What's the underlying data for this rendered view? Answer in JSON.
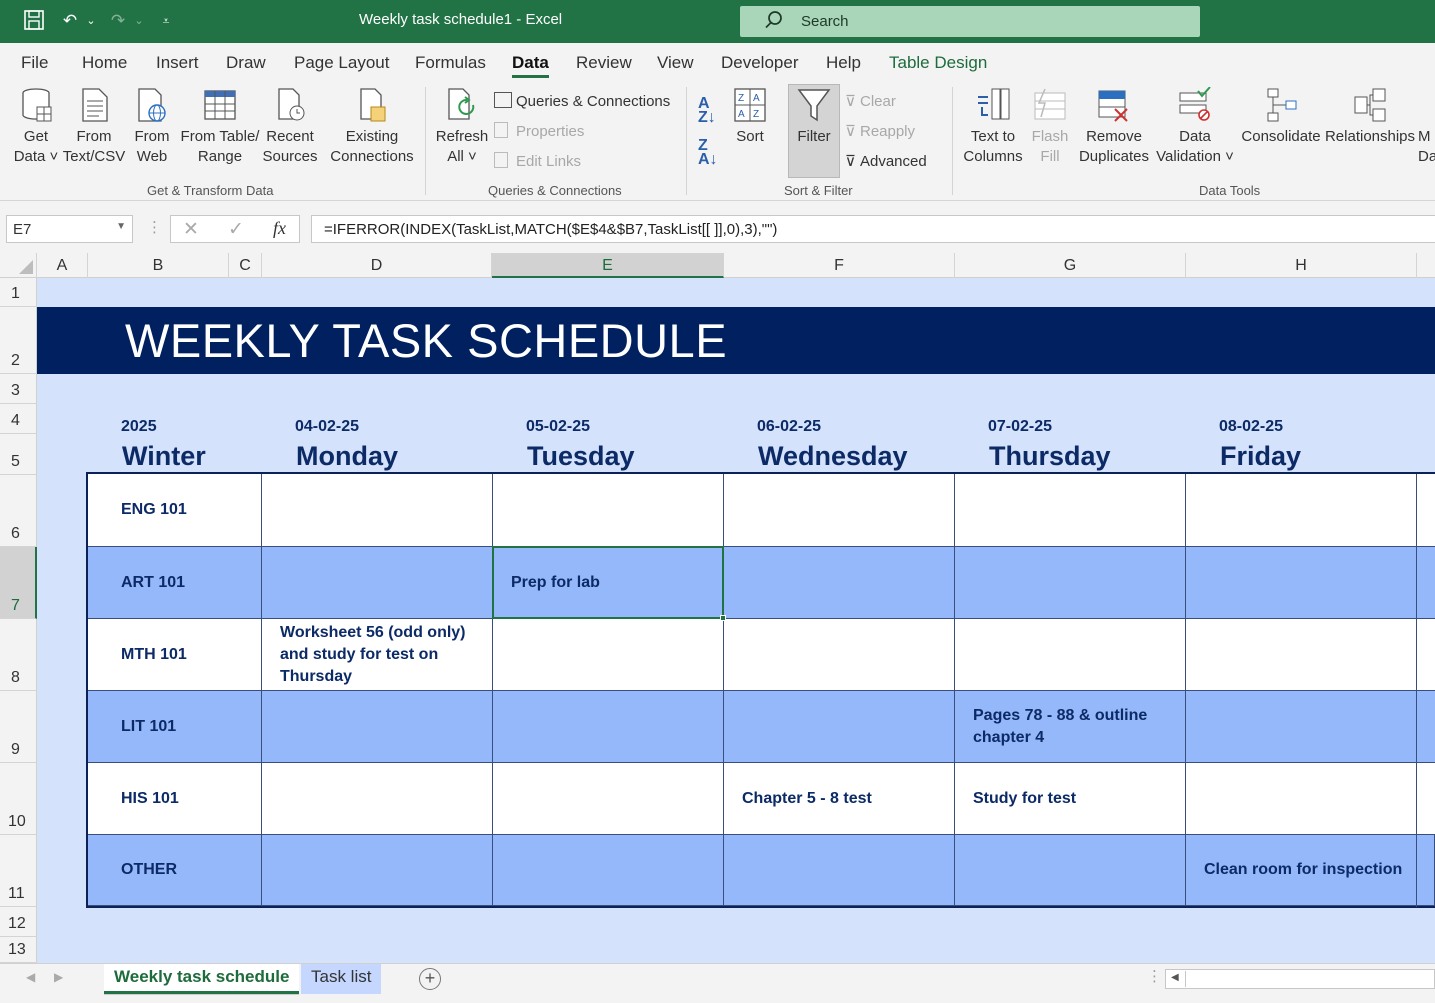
{
  "titlebar": {
    "doc_title": "Weekly task schedule1  -  Excel",
    "search_label": "Search"
  },
  "menu": {
    "items": [
      "File",
      "Home",
      "Insert",
      "Draw",
      "Page Layout",
      "Formulas",
      "Data",
      "Review",
      "View",
      "Developer",
      "Help",
      "Table Design"
    ],
    "active": "Data"
  },
  "ribbon": {
    "get_data": "Get\nData ˅",
    "from_text": "From\nText/CSV",
    "from_web": "From\nWeb",
    "from_table": "From Table/\nRange",
    "recent_sources": "Recent\nSources",
    "existing_connections": "Existing\nConnections",
    "group_get_transform": "Get & Transform Data",
    "refresh_all": "Refresh\nAll ˅",
    "queries_connections": "Queries & Connections",
    "properties": "Properties",
    "edit_links": "Edit Links",
    "group_queries": "Queries & Connections",
    "sort": "Sort",
    "filter": "Filter",
    "clear": "Clear",
    "reapply": "Reapply",
    "advanced": "Advanced",
    "group_sort_filter": "Sort & Filter",
    "text_to_columns": "Text to\nColumns",
    "flash_fill": "Flash\nFill",
    "remove_duplicates": "Remove\nDuplicates",
    "data_validation": "Data\nValidation ˅",
    "consolidate": "Consolidate",
    "relationships": "Relationships",
    "manage_partial": "M\nDa",
    "group_data_tools": "Data Tools"
  },
  "formula_bar": {
    "name_box": "E7",
    "formula": "=IFERROR(INDEX(TaskList,MATCH($E$4&$B7,TaskList[[ ]],0),3),\"\")"
  },
  "columns": [
    "A",
    "B",
    "C",
    "D",
    "E",
    "F",
    "G",
    "H"
  ],
  "rows": [
    "1",
    "2",
    "3",
    "4",
    "5",
    "6",
    "7",
    "8",
    "9",
    "10",
    "11",
    "12",
    "13"
  ],
  "schedule": {
    "title": "WEEKLY TASK SCHEDULE",
    "year": "2025",
    "season": "Winter",
    "days": [
      {
        "date": "04-02-25",
        "name": "Monday"
      },
      {
        "date": "05-02-25",
        "name": "Tuesday"
      },
      {
        "date": "06-02-25",
        "name": "Wednesday"
      },
      {
        "date": "07-02-25",
        "name": "Thursday"
      },
      {
        "date": "08-02-25",
        "name": "Friday"
      }
    ],
    "rows": [
      {
        "course": "ENG 101",
        "tasks": [
          "",
          "",
          "",
          "",
          ""
        ]
      },
      {
        "course": "ART 101",
        "tasks": [
          "",
          "Prep for lab",
          "",
          "",
          ""
        ]
      },
      {
        "course": "MTH 101",
        "tasks": [
          "Worksheet 56 (odd only) and study for test on Thursday",
          "",
          "",
          "",
          ""
        ]
      },
      {
        "course": "LIT 101",
        "tasks": [
          "",
          "",
          "",
          "Pages 78 - 88 & outline chapter 4",
          ""
        ]
      },
      {
        "course": "HIS 101",
        "tasks": [
          "",
          "",
          "Chapter 5 - 8 test",
          "Study for test",
          ""
        ]
      },
      {
        "course": "OTHER",
        "tasks": [
          "",
          "",
          "",
          "",
          "Clean room for inspection"
        ]
      }
    ]
  },
  "sheet_tabs": [
    {
      "label": "Weekly task schedule",
      "active": true
    },
    {
      "label": "Task list",
      "active": false
    }
  ],
  "colors": {
    "excel_green": "#217346",
    "banner": "#002060",
    "band_blue": "#95b8fb",
    "sheet_bg": "#d5e2fb"
  }
}
